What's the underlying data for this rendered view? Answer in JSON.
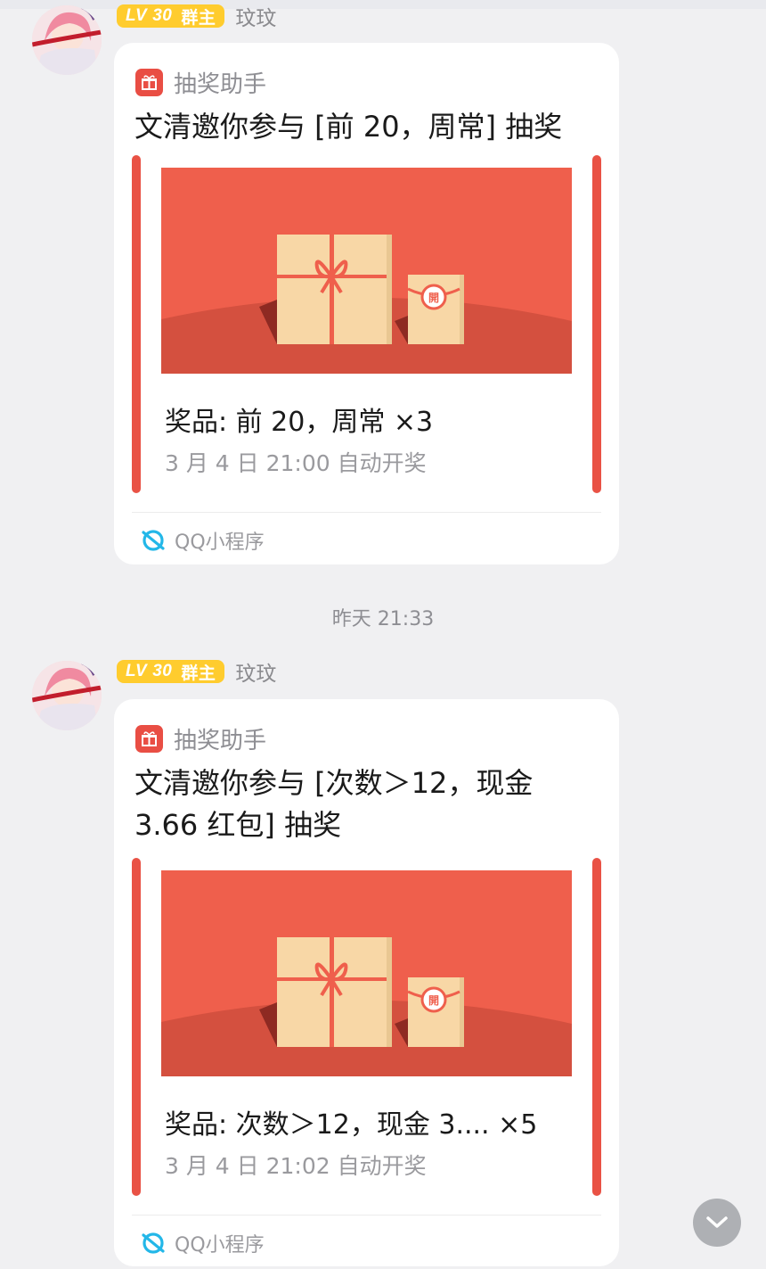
{
  "messages": [
    {
      "sender": {
        "level": "LV",
        "level_num": "30",
        "role": "群主",
        "nickname": "玟玟"
      },
      "card": {
        "app_name": "抽奖助手",
        "title": "文清邀你参与 [前 20，周常] 抽奖",
        "prize_name": "奖品: 前 20，周常 ×3",
        "prize_time": "3 月 4 日 21:00 自动开奖",
        "mini_program": "QQ小程序"
      }
    },
    {
      "sender": {
        "level": "LV",
        "level_num": "30",
        "role": "群主",
        "nickname": "玟玟"
      },
      "card": {
        "app_name": "抽奖助手",
        "title": "文清邀你参与 [次数＞12，现金 3.66 红包] 抽奖",
        "prize_name": "奖品: 次数＞12，现金 3.... ×5",
        "prize_time": "3 月 4 日 21:02 自动开奖",
        "mini_program": "QQ小程序"
      }
    }
  ],
  "timestamp": "昨天 21:33",
  "icons": {
    "app": "gift-icon",
    "mini": "qq-miniprogram-icon",
    "scroll": "chevron-down-icon",
    "seal": "開"
  },
  "colors": {
    "banner": "#ef5f4c",
    "accent_bar": "#e95245",
    "badge": "#ffcc2e",
    "gift": "#f8d7a6",
    "mini_icon": "#23b7e8"
  }
}
